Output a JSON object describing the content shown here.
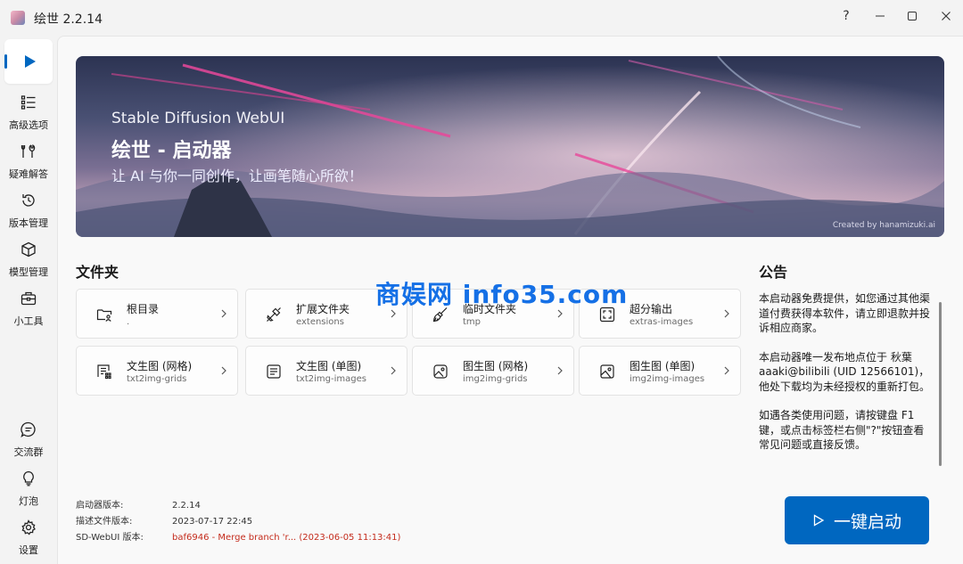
{
  "window": {
    "title": "绘世 2.2.14",
    "help_label": "?"
  },
  "sidebar": {
    "top_items": [
      {
        "label": "高级选项",
        "icon": "list-icon"
      },
      {
        "label": "疑难解答",
        "icon": "tools-icon"
      },
      {
        "label": "版本管理",
        "icon": "history-icon"
      },
      {
        "label": "模型管理",
        "icon": "cube-icon"
      },
      {
        "label": "小工具",
        "icon": "toolbox-icon"
      }
    ],
    "bottom_items": [
      {
        "label": "交流群",
        "icon": "chat-icon"
      },
      {
        "label": "灯泡",
        "icon": "lightbulb-icon"
      },
      {
        "label": "设置",
        "icon": "gear-icon"
      }
    ]
  },
  "banner": {
    "subtitle": "Stable Diffusion WebUI",
    "title": "绘世 - 启动器",
    "slogan": "让 AI 与你一同创作，让画笔随心所欲！",
    "credit": "Created by hanamizuki.ai"
  },
  "folders": {
    "title": "文件夹",
    "items": [
      {
        "name": "根目录",
        "path": ".",
        "icon": "folder-user-icon"
      },
      {
        "name": "扩展文件夹",
        "path": "extensions",
        "icon": "plug-icon"
      },
      {
        "name": "临时文件夹",
        "path": "tmp",
        "icon": "broom-icon"
      },
      {
        "name": "超分输出",
        "path": "extras-images",
        "icon": "expand-icon"
      },
      {
        "name": "文生图 (网格)",
        "path": "txt2img-grids",
        "icon": "text-grid-icon"
      },
      {
        "name": "文生图 (单图)",
        "path": "txt2img-images",
        "icon": "text-doc-icon"
      },
      {
        "name": "图生图 (网格)",
        "path": "img2img-grids",
        "icon": "image-grid-icon"
      },
      {
        "name": "图生图 (单图)",
        "path": "img2img-images",
        "icon": "image-icon"
      }
    ]
  },
  "notice": {
    "title": "公告",
    "paragraphs": [
      "本启动器免费提供，如您通过其他渠道付费获得本软件，请立即退款并投诉相应商家。",
      "本启动器唯一发布地点位于 秋葉aaaki@bilibili (UID 12566101)，他处下载均为未经授权的重新打包。",
      "如遇各类使用问题，请按键盘 F1 键，或点击标签栏右侧\"?\"按钮查看常见问题或直接反馈。"
    ]
  },
  "versions": [
    {
      "label": "启动器版本:",
      "value": "2.2.14",
      "highlight": false
    },
    {
      "label": "描述文件版本:",
      "value": "2023-07-17 22:45",
      "highlight": false
    },
    {
      "label": "SD-WebUI 版本:",
      "value": "baf6946 - Merge branch 'r... (2023-06-05 11:13:41)",
      "highlight": true
    }
  ],
  "launch_button": {
    "label": "一键启动"
  },
  "watermark": "商娱网 info35.com",
  "colors": {
    "accent": "#0067c0",
    "warning_text": "#c42b1c"
  }
}
